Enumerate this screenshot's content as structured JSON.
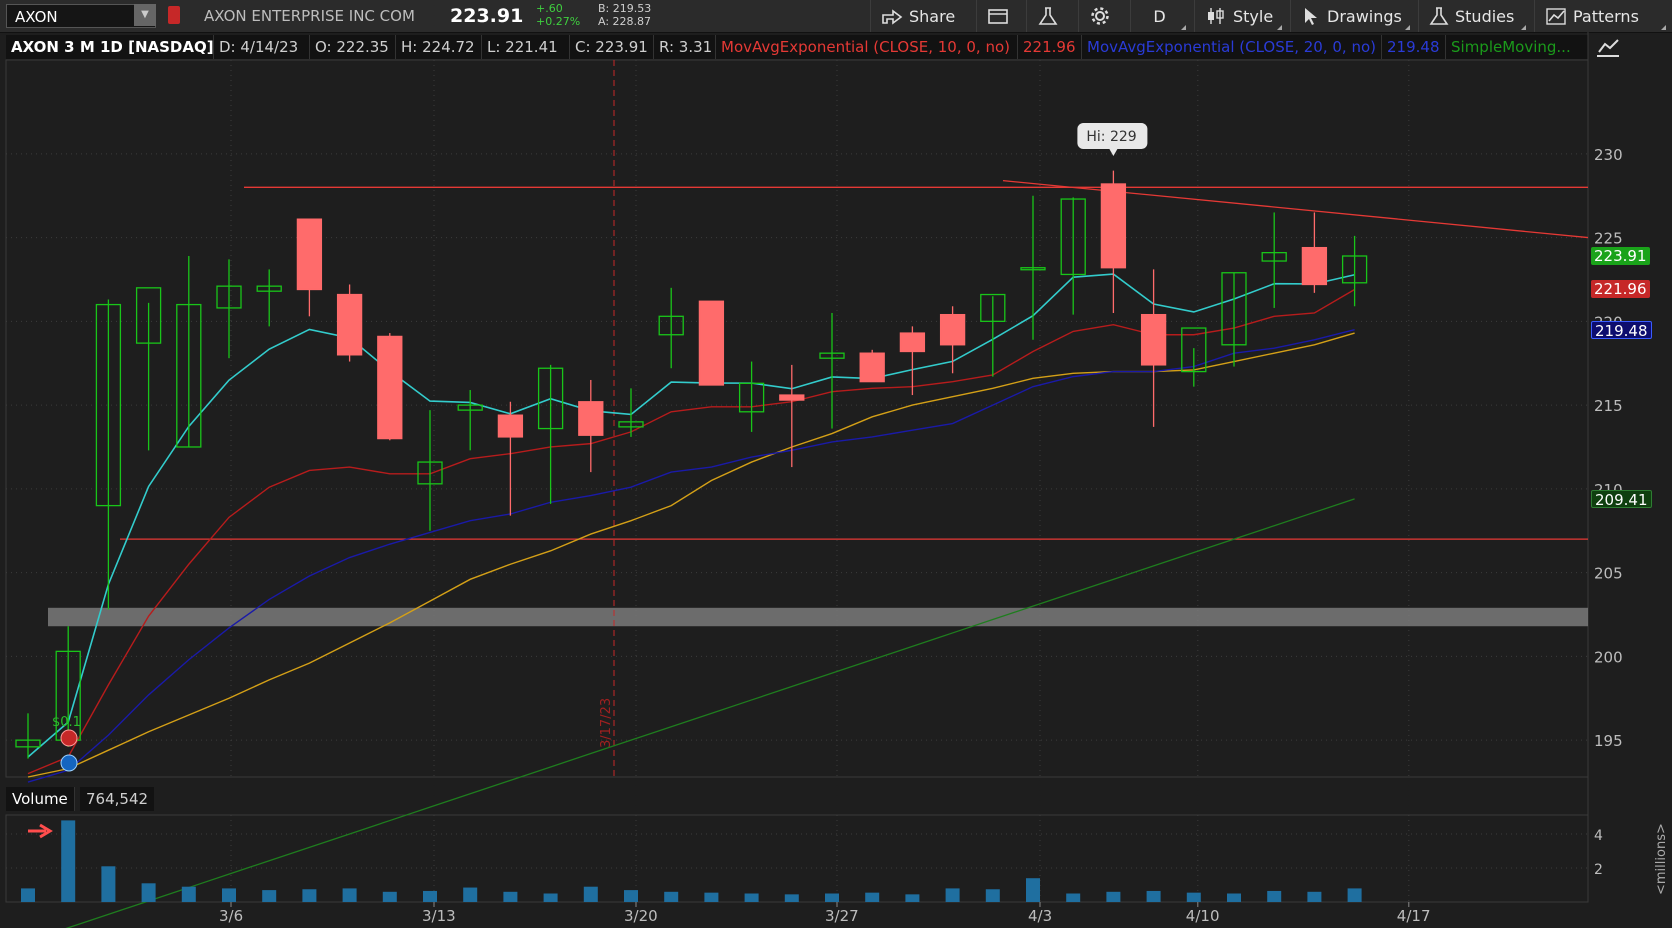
{
  "toolbar": {
    "symbol": "AXON",
    "company": "AXON ENTERPRISE INC COM",
    "last": "223.91",
    "change_abs": "+.60",
    "change_pct": "+0.27%",
    "bid": "B: 219.53",
    "ask": "A: 228.87",
    "share_label": "Share",
    "period_label": "D",
    "style_label": "Style",
    "drawings_label": "Drawings",
    "studies_label": "Studies",
    "patterns_label": "Patterns"
  },
  "header": {
    "title": "AXON 3 M 1D [NASDAQ]",
    "date": "D: 4/14/23",
    "open": "O: 222.35",
    "high": "H: 224.72",
    "low": "L: 221.41",
    "close": "C: 223.91",
    "range": "R: 3.31",
    "ema10": "MovAvgExponential (CLOSE, 10, 0, no)",
    "ema10_value": "221.96",
    "ema20": "MovAvgExponential (CLOSE, 20, 0, no)",
    "ema20_value": "219.48",
    "sma": "SimpleMoving..."
  },
  "price_labels": {
    "last": "223.91",
    "ema10": "221.96",
    "ema20": "219.48",
    "sma": "209.41"
  },
  "annotations": {
    "high": "Hi: 229",
    "dividend": "$0.1",
    "date_line": "3/17/23"
  },
  "volume": {
    "label": "Volume",
    "value": "764,542",
    "axis_unit": "<millions>"
  },
  "colors": {
    "up": "#19c519",
    "down": "#ff6b6b",
    "ema10": "#b71c1c",
    "ema20": "#1a1aa8",
    "ema_fast": "#33cccc",
    "ema_gold": "#d4a017",
    "sma": "#1e7d1e",
    "volume": "#1f6fa0",
    "level_line": "#e53935"
  },
  "chart_data": {
    "type": "candlestick",
    "x": [
      "2/27",
      "2/28",
      "3/1",
      "3/2",
      "3/3",
      "3/6",
      "3/7",
      "3/8",
      "3/9",
      "3/10",
      "3/13",
      "3/14",
      "3/15",
      "3/16",
      "3/17",
      "3/20",
      "3/21",
      "3/22",
      "3/23",
      "3/24",
      "3/27",
      "3/28",
      "3/29",
      "3/30",
      "3/31",
      "4/3",
      "4/4",
      "4/5",
      "4/6",
      "4/10",
      "4/11",
      "4/12",
      "4/13",
      "4/14"
    ],
    "x_ticks": [
      "3/6",
      "3/13",
      "3/20",
      "3/27",
      "4/3",
      "4/10",
      "4/17"
    ],
    "y_ticks": [
      195,
      200,
      205,
      210,
      215,
      220,
      225,
      230
    ],
    "ylim": [
      192.8,
      235.6
    ],
    "series": [
      {
        "name": "AXON",
        "open": [
          194.6,
          195.0,
          209.0,
          218.7,
          212.5,
          220.8,
          221.8,
          226.1,
          221.6,
          219.1,
          210.3,
          214.7,
          214.4,
          213.6,
          215.2,
          213.7,
          219.2,
          221.2,
          214.6,
          215.6,
          217.8,
          218.1,
          219.3,
          220.4,
          220.0,
          223.2,
          222.8,
          228.2,
          220.4,
          217.0,
          218.6,
          223.6,
          224.4,
          222.3
        ],
        "high": [
          196.6,
          201.8,
          221.3,
          221.1,
          223.9,
          223.7,
          223.1,
          226.1,
          222.2,
          219.3,
          214.7,
          215.9,
          215.2,
          217.4,
          216.5,
          216.0,
          222.0,
          221.2,
          217.6,
          217.4,
          220.5,
          218.3,
          219.7,
          220.9,
          221.5,
          227.5,
          227.4,
          229.0,
          223.1,
          218.4,
          222.9,
          226.5,
          226.5,
          225.1
        ],
        "low": [
          193.9,
          194.6,
          202.8,
          212.3,
          212.5,
          217.8,
          219.7,
          220.3,
          217.6,
          212.9,
          207.5,
          212.3,
          208.4,
          209.1,
          211.0,
          213.1,
          217.2,
          216.2,
          213.4,
          211.3,
          213.6,
          216.6,
          215.6,
          216.9,
          216.7,
          218.9,
          220.4,
          220.5,
          213.7,
          216.1,
          217.3,
          220.8,
          221.7,
          220.9
        ],
        "close": [
          195.0,
          200.3,
          221.0,
          222.0,
          221.0,
          222.1,
          222.1,
          221.9,
          218.0,
          213.0,
          211.6,
          215.0,
          213.1,
          217.2,
          213.2,
          214.0,
          220.3,
          216.2,
          216.3,
          215.3,
          218.1,
          216.4,
          218.2,
          218.6,
          221.6,
          223.2,
          227.3,
          223.2,
          217.4,
          219.6,
          222.9,
          224.1,
          222.2,
          223.9
        ],
        "color": "#19c519"
      },
      {
        "name": "MovAvgExponential (CLOSE, 10, 0, no)",
        "values": [
          193.0,
          194.0,
          198.3,
          202.4,
          205.5,
          208.3,
          210.1,
          211.1,
          211.3,
          210.9,
          210.9,
          211.8,
          212.1,
          212.5,
          212.7,
          213.4,
          214.6,
          214.9,
          214.9,
          215.2,
          215.8,
          216.0,
          216.1,
          216.4,
          216.8,
          218.2,
          219.4,
          219.8,
          219.2,
          219.2,
          219.6,
          220.3,
          220.5,
          221.9
        ],
        "color": "#b71c1c"
      },
      {
        "name": "MovAvgExponential (CLOSE, 20, 0, no)",
        "values": [
          192.5,
          193.2,
          195.3,
          197.7,
          199.8,
          201.7,
          203.4,
          204.8,
          205.9,
          206.7,
          207.4,
          208.1,
          208.5,
          209.2,
          209.6,
          210.1,
          211.0,
          211.3,
          211.9,
          212.3,
          212.8,
          213.1,
          213.5,
          213.9,
          215.0,
          216.1,
          216.7,
          217.0,
          217.0,
          217.3,
          218.1,
          218.4,
          218.9,
          219.5
        ],
        "color": "#1a1aa8"
      },
      {
        "name": "SimpleMoving...",
        "values": [
          183.0,
          183.8,
          184.6,
          185.4,
          186.2,
          187.0,
          187.8,
          188.6,
          189.4,
          190.2,
          191.0,
          191.8,
          192.6,
          193.4,
          194.2,
          195.0,
          195.8,
          196.6,
          197.4,
          198.2,
          199.0,
          199.8,
          200.6,
          201.4,
          202.2,
          203.0,
          203.8,
          204.6,
          205.4,
          206.2,
          207.0,
          207.8,
          208.6,
          209.4
        ],
        "color": "#1e7d1e"
      }
    ],
    "volume_millions": [
      0.8,
      4.8,
      2.1,
      1.1,
      0.9,
      0.8,
      0.7,
      0.75,
      0.8,
      0.6,
      0.65,
      0.85,
      0.6,
      0.5,
      0.9,
      0.7,
      0.6,
      0.55,
      0.5,
      0.45,
      0.5,
      0.55,
      0.45,
      0.8,
      0.75,
      1.4,
      0.5,
      0.6,
      0.65,
      0.55,
      0.5,
      0.65,
      0.6,
      0.8
    ],
    "volume_ylim": [
      0,
      5
    ],
    "volume_ticks": [
      2,
      4
    ],
    "grid": true
  }
}
